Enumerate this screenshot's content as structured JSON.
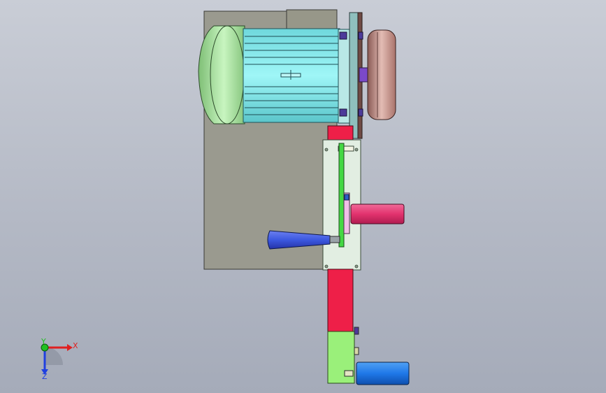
{
  "window": {
    "background_top": "#c9cdd6",
    "background_bottom": "#a5abb9"
  },
  "model": {
    "parts": [
      "base-plate",
      "motor-housing",
      "motor-end-cap",
      "motor-fins",
      "motor-top-box",
      "flange-plate",
      "pulley-wheel",
      "shaft-hub",
      "vertical-support",
      "side-plate",
      "green-link-bar",
      "pink-cylinder",
      "blue-handle",
      "lower-red-bar",
      "green-block",
      "blue-cylinder"
    ],
    "colors": {
      "base_plate": "#9a9a8f",
      "motor_cap": "#a8e6a0",
      "motor_body": "#8ef0f2",
      "flange": "#b9e8e6",
      "pulley": "#d4a7a0",
      "hub": "#7b49c8",
      "red_support": "#ee1f48",
      "side_plate": "#e2eee2",
      "green_bar": "#44d844",
      "pink_cylinder": "#e23a78",
      "blue_handle": "#3c58e0",
      "green_block": "#9af07a",
      "blue_cylinder": "#1f78e8"
    }
  },
  "triad": {
    "x_label": "X",
    "y_label": "Y",
    "z_label": "Z",
    "x_color": "#e02020",
    "y_color": "#20c020",
    "z_color": "#2040e0"
  }
}
